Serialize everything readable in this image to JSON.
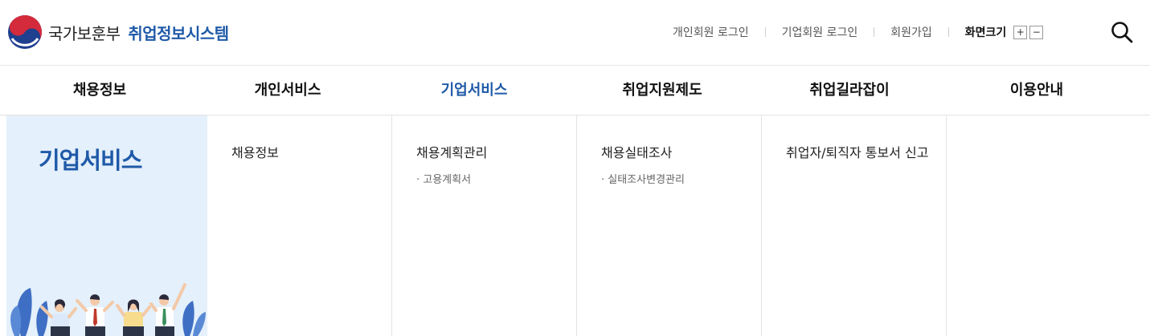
{
  "header": {
    "org_name": "국가보훈부",
    "system_name": "취업정보시스템",
    "util_links": [
      "개인회원 로그인",
      "기업회원 로그인",
      "회원가입"
    ],
    "font_size_label": "화면크기",
    "font_plus": "+",
    "font_minus": "−"
  },
  "nav": {
    "items": [
      "채용정보",
      "개인서비스",
      "기업서비스",
      "취업지원제도",
      "취업길라잡이",
      "이용안내"
    ],
    "active": "기업서비스"
  },
  "mega": {
    "section_title": "기업서비스",
    "columns": [
      {
        "title": "채용정보",
        "subs": []
      },
      {
        "title": "채용계획관리",
        "subs": [
          "· 고용계획서"
        ]
      },
      {
        "title": "채용실태조사",
        "subs": [
          "· 실태조사변경관리"
        ]
      },
      {
        "title": "취업자/퇴직자 통보서 신고",
        "subs": []
      }
    ]
  },
  "colors": {
    "brand_blue": "#1f5aa8",
    "side_bg": "#e4f0fb"
  },
  "icons": {
    "logo": "taegeuk-logo-icon",
    "search": "search-icon"
  }
}
